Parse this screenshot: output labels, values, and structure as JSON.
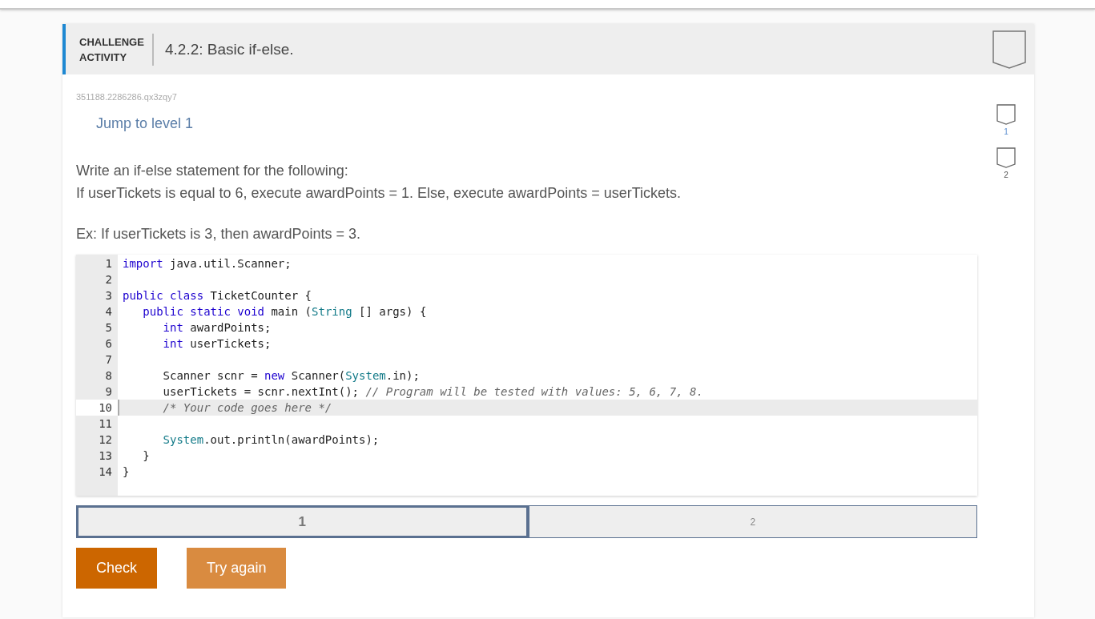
{
  "header": {
    "kind_label": "CHALLENGE ACTIVITY",
    "title": "4.2.2: Basic if-else."
  },
  "activity_id": "351188.2286286.qx3zqy7",
  "jump_link": "Jump to level 1",
  "instructions": [
    "Write an if-else statement for the following:",
    "If userTickets is equal to 6, execute awardPoints = 1. Else, execute awardPoints = userTickets."
  ],
  "example": "Ex: If userTickets is 3, then awardPoints = 3.",
  "code_lines": [
    {
      "number": "1",
      "current": false,
      "segments": [
        {
          "kind": "keyword",
          "text": "import"
        },
        {
          "kind": "plain",
          "text": " java.util.Scanner;"
        }
      ]
    },
    {
      "number": "2",
      "current": false
    },
    {
      "number": "3",
      "current": false,
      "segments": [
        {
          "kind": "keyword",
          "text": "public class"
        },
        {
          "kind": "plain",
          "text": " TicketCounter {"
        }
      ]
    },
    {
      "number": "4",
      "current": false,
      "segments": [
        {
          "kind": "keyword",
          "text": "   public static void"
        },
        {
          "kind": "plain",
          "text": " main ("
        },
        {
          "kind": "type",
          "text": "String"
        },
        {
          "kind": "plain",
          "text": " [] args) {"
        }
      ]
    },
    {
      "number": "5",
      "current": false,
      "segments": [
        {
          "kind": "keyword",
          "text": "      int"
        },
        {
          "kind": "plain",
          "text": " awardPoints;"
        }
      ]
    },
    {
      "number": "6",
      "current": false,
      "segments": [
        {
          "kind": "keyword",
          "text": "      int"
        },
        {
          "kind": "plain",
          "text": " userTickets;"
        }
      ]
    },
    {
      "number": "7",
      "current": false
    },
    {
      "number": "8",
      "current": false,
      "segments": [
        {
          "kind": "plain",
          "text": "      Scanner scnr = "
        },
        {
          "kind": "keyword",
          "text": "new"
        },
        {
          "kind": "plain",
          "text": " Scanner("
        },
        {
          "kind": "type",
          "text": "System"
        },
        {
          "kind": "plain",
          "text": ".in);"
        }
      ]
    },
    {
      "number": "9",
      "current": false,
      "segments": [
        {
          "kind": "plain",
          "text": "      userTickets = scnr.nextInt(); "
        },
        {
          "kind": "comment",
          "text": "// Program will be tested with values: 5, 6, 7, 8."
        }
      ]
    },
    {
      "number": "10",
      "current": true,
      "segments": [
        {
          "kind": "comment",
          "text": "      /* Your code goes here */"
        }
      ]
    },
    {
      "number": "11",
      "current": false
    },
    {
      "number": "12",
      "current": false,
      "segments": [
        {
          "kind": "type",
          "text": "      System"
        },
        {
          "kind": "plain",
          "text": ".out.println(awardPoints);"
        }
      ]
    },
    {
      "number": "13",
      "current": false,
      "segments": [
        {
          "kind": "plain",
          "text": "   }"
        }
      ]
    },
    {
      "number": "14",
      "current": false,
      "segments": [
        {
          "kind": "plain",
          "text": "}"
        }
      ]
    }
  ],
  "level_tabs": [
    {
      "label": "1",
      "selected": true
    },
    {
      "label": "2",
      "selected": false
    }
  ],
  "buttons": [
    {
      "label": "Check",
      "disabled": false
    },
    {
      "label": "Try again",
      "disabled": true
    }
  ],
  "level_markers": [
    {
      "label": "1",
      "selected": true
    },
    {
      "label": "2",
      "selected": false
    }
  ]
}
